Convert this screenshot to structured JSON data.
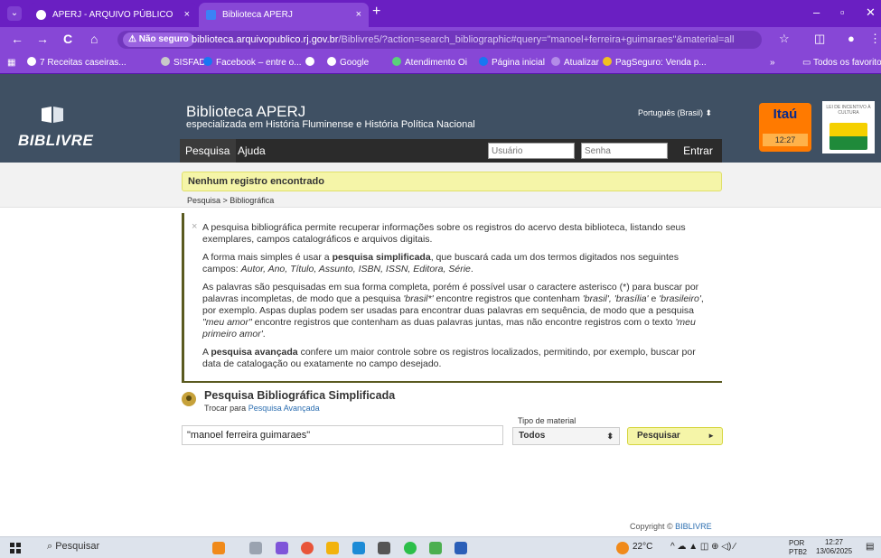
{
  "browser": {
    "tabs": [
      {
        "title": "APERJ - ARQUIVO PÚBLICO",
        "close": "×"
      },
      {
        "title": "Biblioteca APERJ",
        "close": "×"
      }
    ],
    "new_tab": "+",
    "window_controls": {
      "minimize": "–",
      "maximize": "▫",
      "close": "✕"
    },
    "nav": {
      "back": "←",
      "forward": "→",
      "reload": "C",
      "home": "⌂"
    },
    "security_label": "⚠ Não seguro",
    "url_host": "biblioteca.arquivopublico.rj.gov.br",
    "url_path": "/Biblivre5/?action=search_bibliographic#query=\"manoel+ferreira+guimaraes\"&material=all",
    "bookmarks": [
      "7 Receitas caseiras...",
      "SISFAD",
      "Facebook – entre o...",
      "Google",
      "Atendimento Oi",
      "Página inicial",
      "Atualizar",
      "PagSeguro: Venda p..."
    ],
    "bookmarks_more": "»",
    "all_favorites": "Todos os favoritos"
  },
  "site": {
    "logo_text": "BIBLIVRE",
    "title": "Biblioteca APERJ",
    "subtitle": "especializada em História Fluminense e História Política Nacional",
    "language": "Português (Brasil) ⬍",
    "menu": {
      "search": "Pesquisa",
      "help": "Ajuda"
    },
    "login": {
      "user_placeholder": "Usuário",
      "password_placeholder": "Senha",
      "submit": "Entrar"
    },
    "ad_itau": {
      "name": "Itaú",
      "time": "12:27"
    },
    "ad_lei": "LEI DE INCENTIVO À CULTURA"
  },
  "alert": "Nenhum registro encontrado",
  "breadcrumb": "Pesquisa > Bibliográfica",
  "help": {
    "close": "×",
    "p1": "A pesquisa bibliográfica permite recuperar informações sobre os registros do acervo desta biblioteca, listando seus exemplares, campos catalográficos e arquivos digitais.",
    "p2a": "A forma mais simples é usar a ",
    "p2b": "pesquisa simplificada",
    "p2c": ", que buscará cada um dos termos digitados nos seguintes campos: ",
    "p2d": "Autor, Ano, Título, Assunto, ISBN, ISSN, Editora, Série",
    "p2e": ".",
    "p3a": "As palavras são pesquisadas em sua forma completa, porém é possível usar o caractere asterisco (*) para buscar por palavras incompletas, de modo que a pesquisa ",
    "p3b": "'brasil*'",
    "p3c": " encontre registros que contenham ",
    "p3d": "'brasil', 'brasília'",
    "p3e": " e ",
    "p3f": "'brasileiro'",
    "p3g": ", por exemplo. Aspas duplas podem ser usadas para encontrar duas palavras em sequência, de modo que a pesquisa ",
    "p3h": "\"meu amor\"",
    "p3i": " encontre registros que contenham as duas palavras juntas, mas não encontre registros com o texto ",
    "p3j": "'meu primeiro amor'",
    "p3k": ".",
    "p4a": "A ",
    "p4b": "pesquisa avançada",
    "p4c": " confere um maior controle sobre os registros localizados, permitindo, por exemplo, buscar por data de catalogação ou exatamente no campo desejado."
  },
  "search": {
    "title": "Pesquisa Bibliográfica Simplificada",
    "switch_prefix": "Trocar para ",
    "switch_link": "Pesquisa Avançada",
    "query": "\"manoel ferreira guimaraes\"",
    "material_label": "Tipo de material",
    "material_value": "Todos",
    "material_arrows": "⬍",
    "button": "Pesquisar",
    "button_arrow": "►"
  },
  "copyright": {
    "prefix": "Copyright © ",
    "link": "BIBLIVRE"
  },
  "taskbar": {
    "search": "Pesquisar",
    "weather": "22°C",
    "lang_top": "POR",
    "lang_bottom": "PTB2",
    "time": "12:27",
    "date": "13/06/2025"
  },
  "colors": {
    "browser_accent": "#6a1fc2",
    "header_bg": "#3f5063",
    "alert_bg": "#f5f5a8",
    "link": "#2a6db0"
  }
}
